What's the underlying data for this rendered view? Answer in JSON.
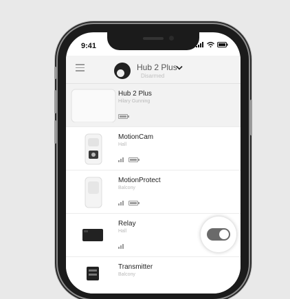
{
  "status_bar": {
    "time": "9:41"
  },
  "header": {
    "hub_name": "Hub 2 Plus",
    "hub_status": "Disarmed"
  },
  "devices": [
    {
      "name": "Hub 2 Plus",
      "location": "Hilary Gunning",
      "signal": null,
      "battery": 1.0
    },
    {
      "name": "MotionCam",
      "location": "Hall",
      "signal": 3,
      "battery": 1.0
    },
    {
      "name": "MotionProtect",
      "location": "Balcony",
      "signal": 3,
      "battery": 1.0
    },
    {
      "name": "Relay",
      "location": "Hall",
      "signal": 3,
      "battery": null,
      "toggle_on": true
    },
    {
      "name": "Transmitter",
      "location": "Balcony",
      "signal": null,
      "battery": null
    }
  ],
  "colors": {
    "toggle_on": "#6a6a6a",
    "appbar": "#f3f3f3"
  }
}
